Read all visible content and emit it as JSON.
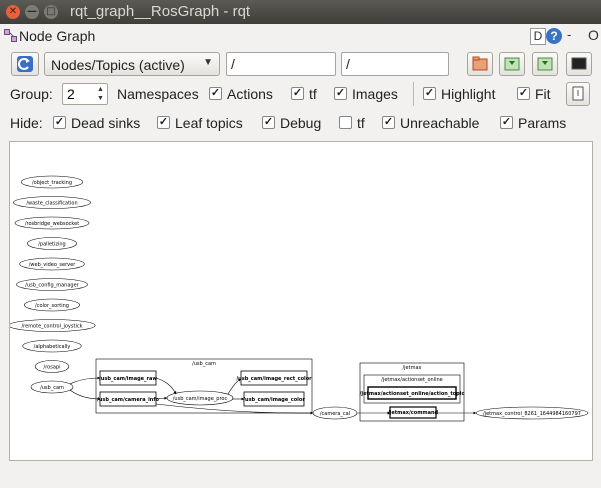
{
  "window": {
    "title": "rqt_graph__RosGraph - rqt"
  },
  "window_controls": {
    "close": "✕",
    "minimize": "—",
    "maximize": "□"
  },
  "plugin": {
    "title": "Node Graph",
    "d_label": "D",
    "help_label": "?",
    "dash": "-",
    "o": "O"
  },
  "toolbar": {
    "mode_selected": "Nodes/Topics (active)",
    "filter_node": "/",
    "filter_topic": "/"
  },
  "group_row": {
    "group_label": "Group:",
    "group_value": "2",
    "namespaces_label": "Namespaces",
    "actions_label": "Actions",
    "actions_checked": true,
    "tf_label": "tf",
    "tf_checked": true,
    "images_label": "Images",
    "images_checked": true,
    "highlight_label": "Highlight",
    "highlight_checked": true,
    "fit_label": "Fit",
    "fit_checked": true
  },
  "hide_row": {
    "hide_label": "Hide:",
    "dead_sinks_label": "Dead sinks",
    "dead_sinks_checked": true,
    "leaf_topics_label": "Leaf topics",
    "leaf_topics_checked": true,
    "debug_label": "Debug",
    "debug_checked": true,
    "tf_label": "tf",
    "tf_checked": false,
    "unreachable_label": "Unreachable",
    "unreachable_checked": true,
    "params_label": "Params",
    "params_checked": true
  },
  "graph": {
    "isolated_nodes": [
      "/object_tracking",
      "/waste_classification",
      "/rosbridge_websocket",
      "/palletizing",
      "/web_video_server",
      "/usb_config_manager",
      "/color_sorting",
      "/remote_control_joystick",
      "/alphabetically",
      "/rosapi"
    ],
    "usb_cam_node": "/usb_cam",
    "usb_cam_cluster": "/usb_cam",
    "topics": {
      "image_raw": "/usb_cam/image_raw",
      "camera_info": "/usb_cam/camera_info",
      "image_proc": "/usb_cam/image_proc",
      "image_rect_color": "/usb_cam/image_rect_color",
      "image_color": "/usb_cam/image_color"
    },
    "camera_cal": "/camera_cal",
    "jetmax_cluster": "/jetmax",
    "jetmax_actionset_cluster": "/jetmax/actionset_online",
    "action_topic": "/jetmax/actionset_online/action_topic",
    "jetmax_command": "/jetmax/command",
    "jetmax_control": "/jetmax_control_8261_1644984160797"
  }
}
